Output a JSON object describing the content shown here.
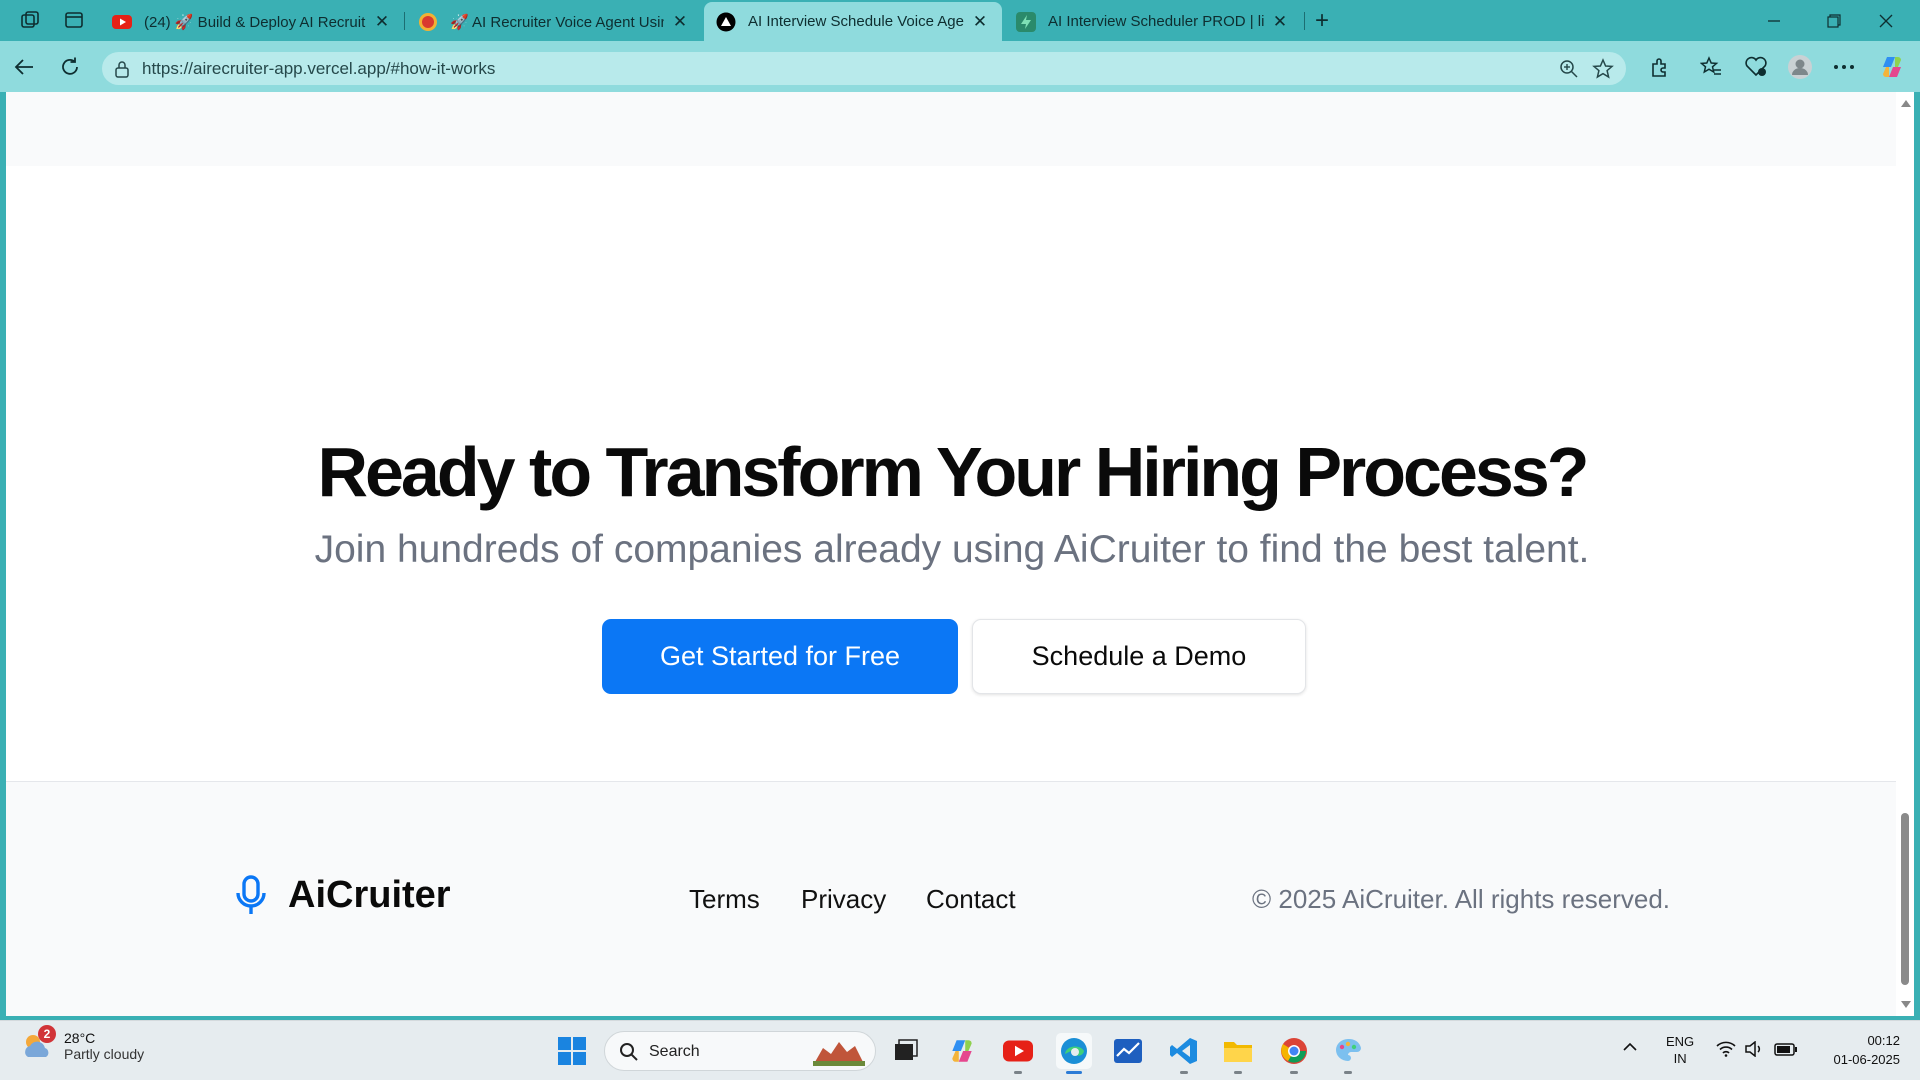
{
  "browser": {
    "tabs": [
      {
        "title": "(24) 🚀 Build & Deploy AI Recruit",
        "favicon": "youtube-icon",
        "active": false
      },
      {
        "title": "🚀 AI Recruiter Voice Agent Using",
        "favicon": "site-favicon-icon",
        "active": false
      },
      {
        "title": "AI Interview Schedule Voice Agent",
        "favicon": "vercel-icon",
        "active": true
      },
      {
        "title": "AI Interview Scheduler PROD | lion",
        "favicon": "supabase-icon",
        "active": false
      }
    ],
    "close_glyph": "✕",
    "new_tab_glyph": "+",
    "url": "https://airecruiter-app.vercel.app/#how-it-works"
  },
  "page": {
    "cta": {
      "title": "Ready to Transform Your Hiring Process?",
      "subtitle": "Join hundreds of companies already using AiCruiter to find the best talent.",
      "primary_button": "Get Started for Free",
      "secondary_button": "Schedule a Demo"
    },
    "footer": {
      "brand": "AiCruiter",
      "links": [
        "Terms",
        "Privacy",
        "Contact"
      ],
      "copyright": "© 2025 AiCruiter. All rights reserved."
    },
    "colors": {
      "primary": "#0b77f5",
      "frame": "#3ab0b4"
    }
  },
  "taskbar": {
    "weather": {
      "temp": "28°C",
      "condition": "Partly cloudy",
      "badge": "2"
    },
    "search_label": "Search",
    "language": {
      "line1": "ENG",
      "line2": "IN"
    },
    "clock": {
      "time": "00:12",
      "date": "01-06-2025"
    }
  }
}
